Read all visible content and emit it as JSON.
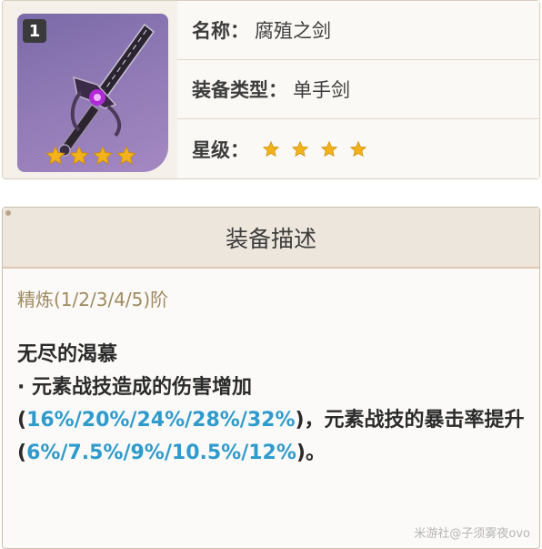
{
  "weapon": {
    "refinement_badge": "1",
    "name_label": "名称：",
    "name": "腐殖之剑",
    "type_label": "装备类型：",
    "type": "单手剑",
    "rarity_label": "星级：",
    "rarity_stars": 4
  },
  "description": {
    "header": "装备描述",
    "refine_levels": "精炼(1/2/3/4/5)阶",
    "effect_title": "无尽的渴慕",
    "effect_segments": [
      {
        "text": "· 元素战技造成的伤害增加(",
        "highlight": false
      },
      {
        "text": "16%/20%/24%/28%/32%",
        "highlight": true
      },
      {
        "text": ")，元素战技的暴击率提升(",
        "highlight": false
      },
      {
        "text": "6%/7.5%/9%/10.5%/12%",
        "highlight": true
      },
      {
        "text": ")。",
        "highlight": false
      }
    ]
  },
  "watermark": "米游社@子须雾夜ovo",
  "colors": {
    "star": "#f2b21c",
    "highlight": "#2f9bcd",
    "refine_text": "#9e8a5f"
  },
  "icons": {
    "star": "star-icon",
    "sword": "sword-icon"
  }
}
